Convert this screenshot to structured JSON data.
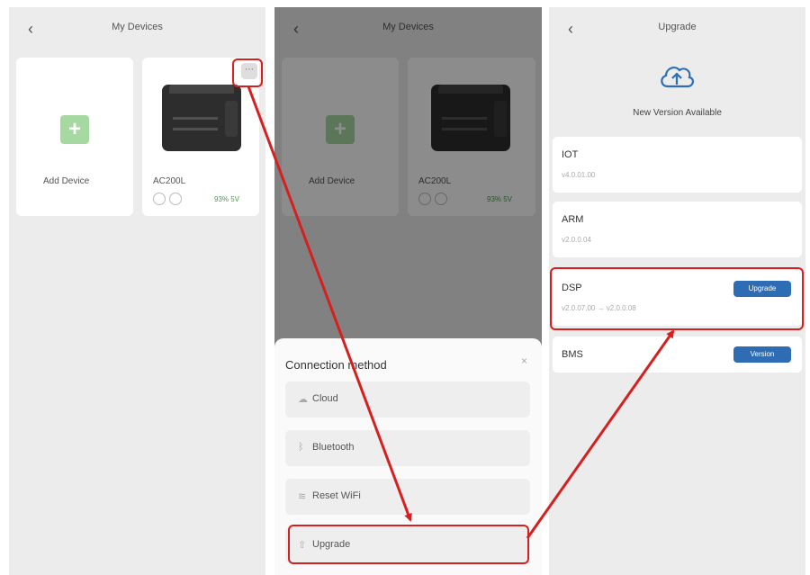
{
  "screen1": {
    "title": "My Devices",
    "add_device_label": "Add Device",
    "device": {
      "name": "AC200L",
      "battery": "93% 5V"
    }
  },
  "screen2": {
    "title": "My Devices",
    "add_device_label": "Add Device",
    "device": {
      "name": "AC200L",
      "battery": "93% 5V"
    },
    "sheet": {
      "title": "Connection method",
      "close": "×",
      "options": [
        {
          "label": "Cloud",
          "icon": "cloud-icon"
        },
        {
          "label": "Bluetooth",
          "icon": "bluetooth-icon"
        },
        {
          "label": "Reset WiFi",
          "icon": "wifi-icon"
        },
        {
          "label": "Upgrade",
          "icon": "upgrade-icon"
        }
      ]
    }
  },
  "screen3": {
    "title": "Upgrade",
    "message": "New Version Available",
    "modules": [
      {
        "name": "IOT",
        "version": "v4.0.01.00",
        "button": ""
      },
      {
        "name": "ARM",
        "version": "v2.0.0.04",
        "button": ""
      },
      {
        "name": "DSP",
        "version": "v2.0.07.00 → v2.0.0.08",
        "button": "Upgrade"
      },
      {
        "name": "BMS",
        "version": "",
        "button": "Version"
      }
    ]
  },
  "colors": {
    "accent": "#2e6db4",
    "highlight": "#d62020",
    "add_green": "#a6d8a2"
  }
}
